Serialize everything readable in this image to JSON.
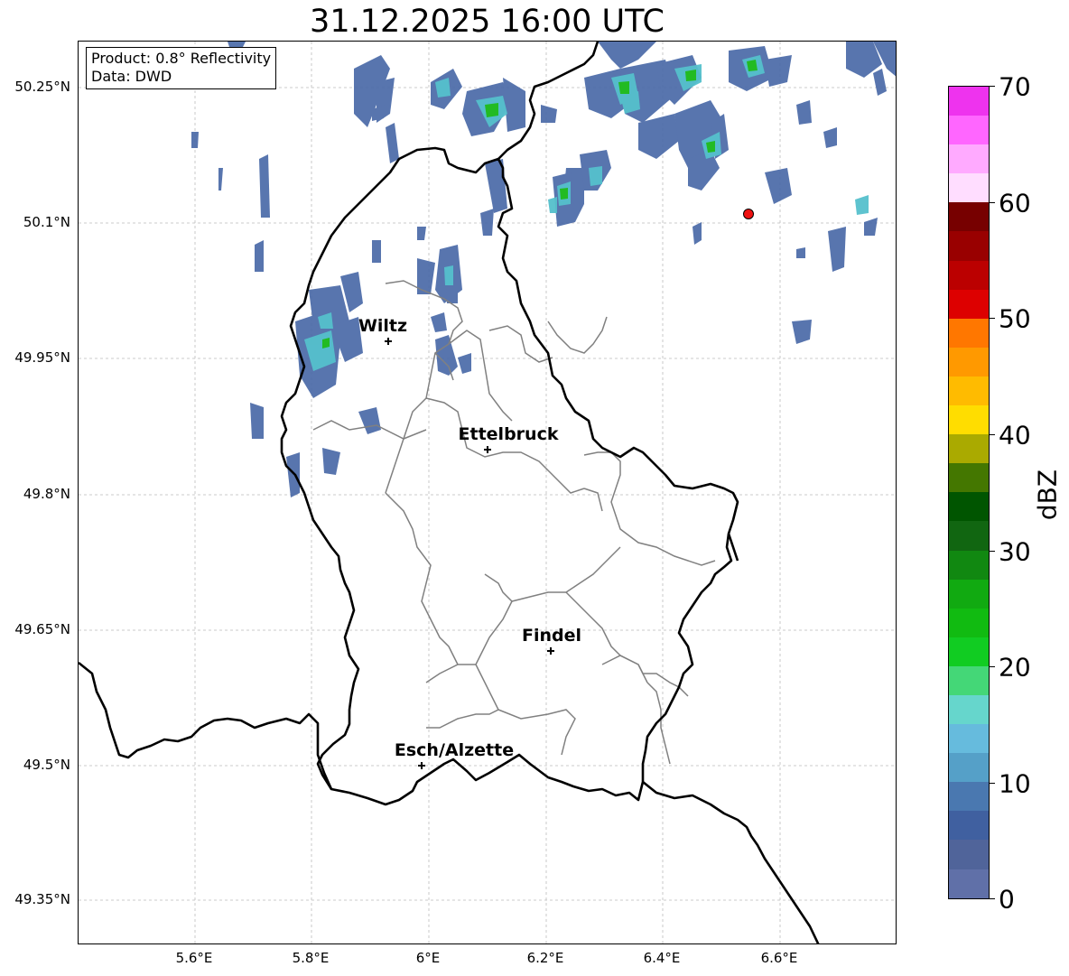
{
  "title": "31.12.2025 16:00 UTC",
  "info": {
    "product": "Product: 0.8° Reflectivity",
    "data": "Data: DWD"
  },
  "axes": {
    "lat_labels": [
      "50.25°N",
      "50.1°N",
      "49.95°N",
      "49.8°N",
      "49.65°N",
      "49.5°N",
      "49.35°N"
    ],
    "lon_labels": [
      "5.6°E",
      "5.8°E",
      "6°E",
      "6.2°E",
      "6.4°E",
      "6.6°E"
    ],
    "grid": true
  },
  "cities": [
    {
      "name": "Wiltz"
    },
    {
      "name": "Ettelbruck"
    },
    {
      "name": "Findel"
    },
    {
      "name": "Esch/Alzette"
    }
  ],
  "colorbar": {
    "label": "dBZ",
    "ticks": [
      "70",
      "60",
      "50",
      "40",
      "30",
      "20",
      "10",
      "0"
    ],
    "colors": [
      "#ee33ee",
      "#ff66ff",
      "#ffaaff",
      "#ffddff",
      "#770000",
      "#990000",
      "#bb0000",
      "#dd0000",
      "#ff7700",
      "#ff9900",
      "#ffbb00",
      "#ffdd00",
      "#aaaa00",
      "#447700",
      "#005500",
      "#116611",
      "#118811",
      "#11aa11",
      "#11bb11",
      "#11cc22",
      "#44d777",
      "#66d6cc",
      "#66bbdd",
      "#55a0c8",
      "#4a78b0",
      "#4060a0",
      "#50649a",
      "#6070a8"
    ]
  },
  "colors": {
    "border": "#000000",
    "canton": "#808080",
    "radar_low": "#4a6aa8",
    "radar_mid": "#55c0cc",
    "radar_high": "#22bb22",
    "poi": "#ee1111"
  }
}
